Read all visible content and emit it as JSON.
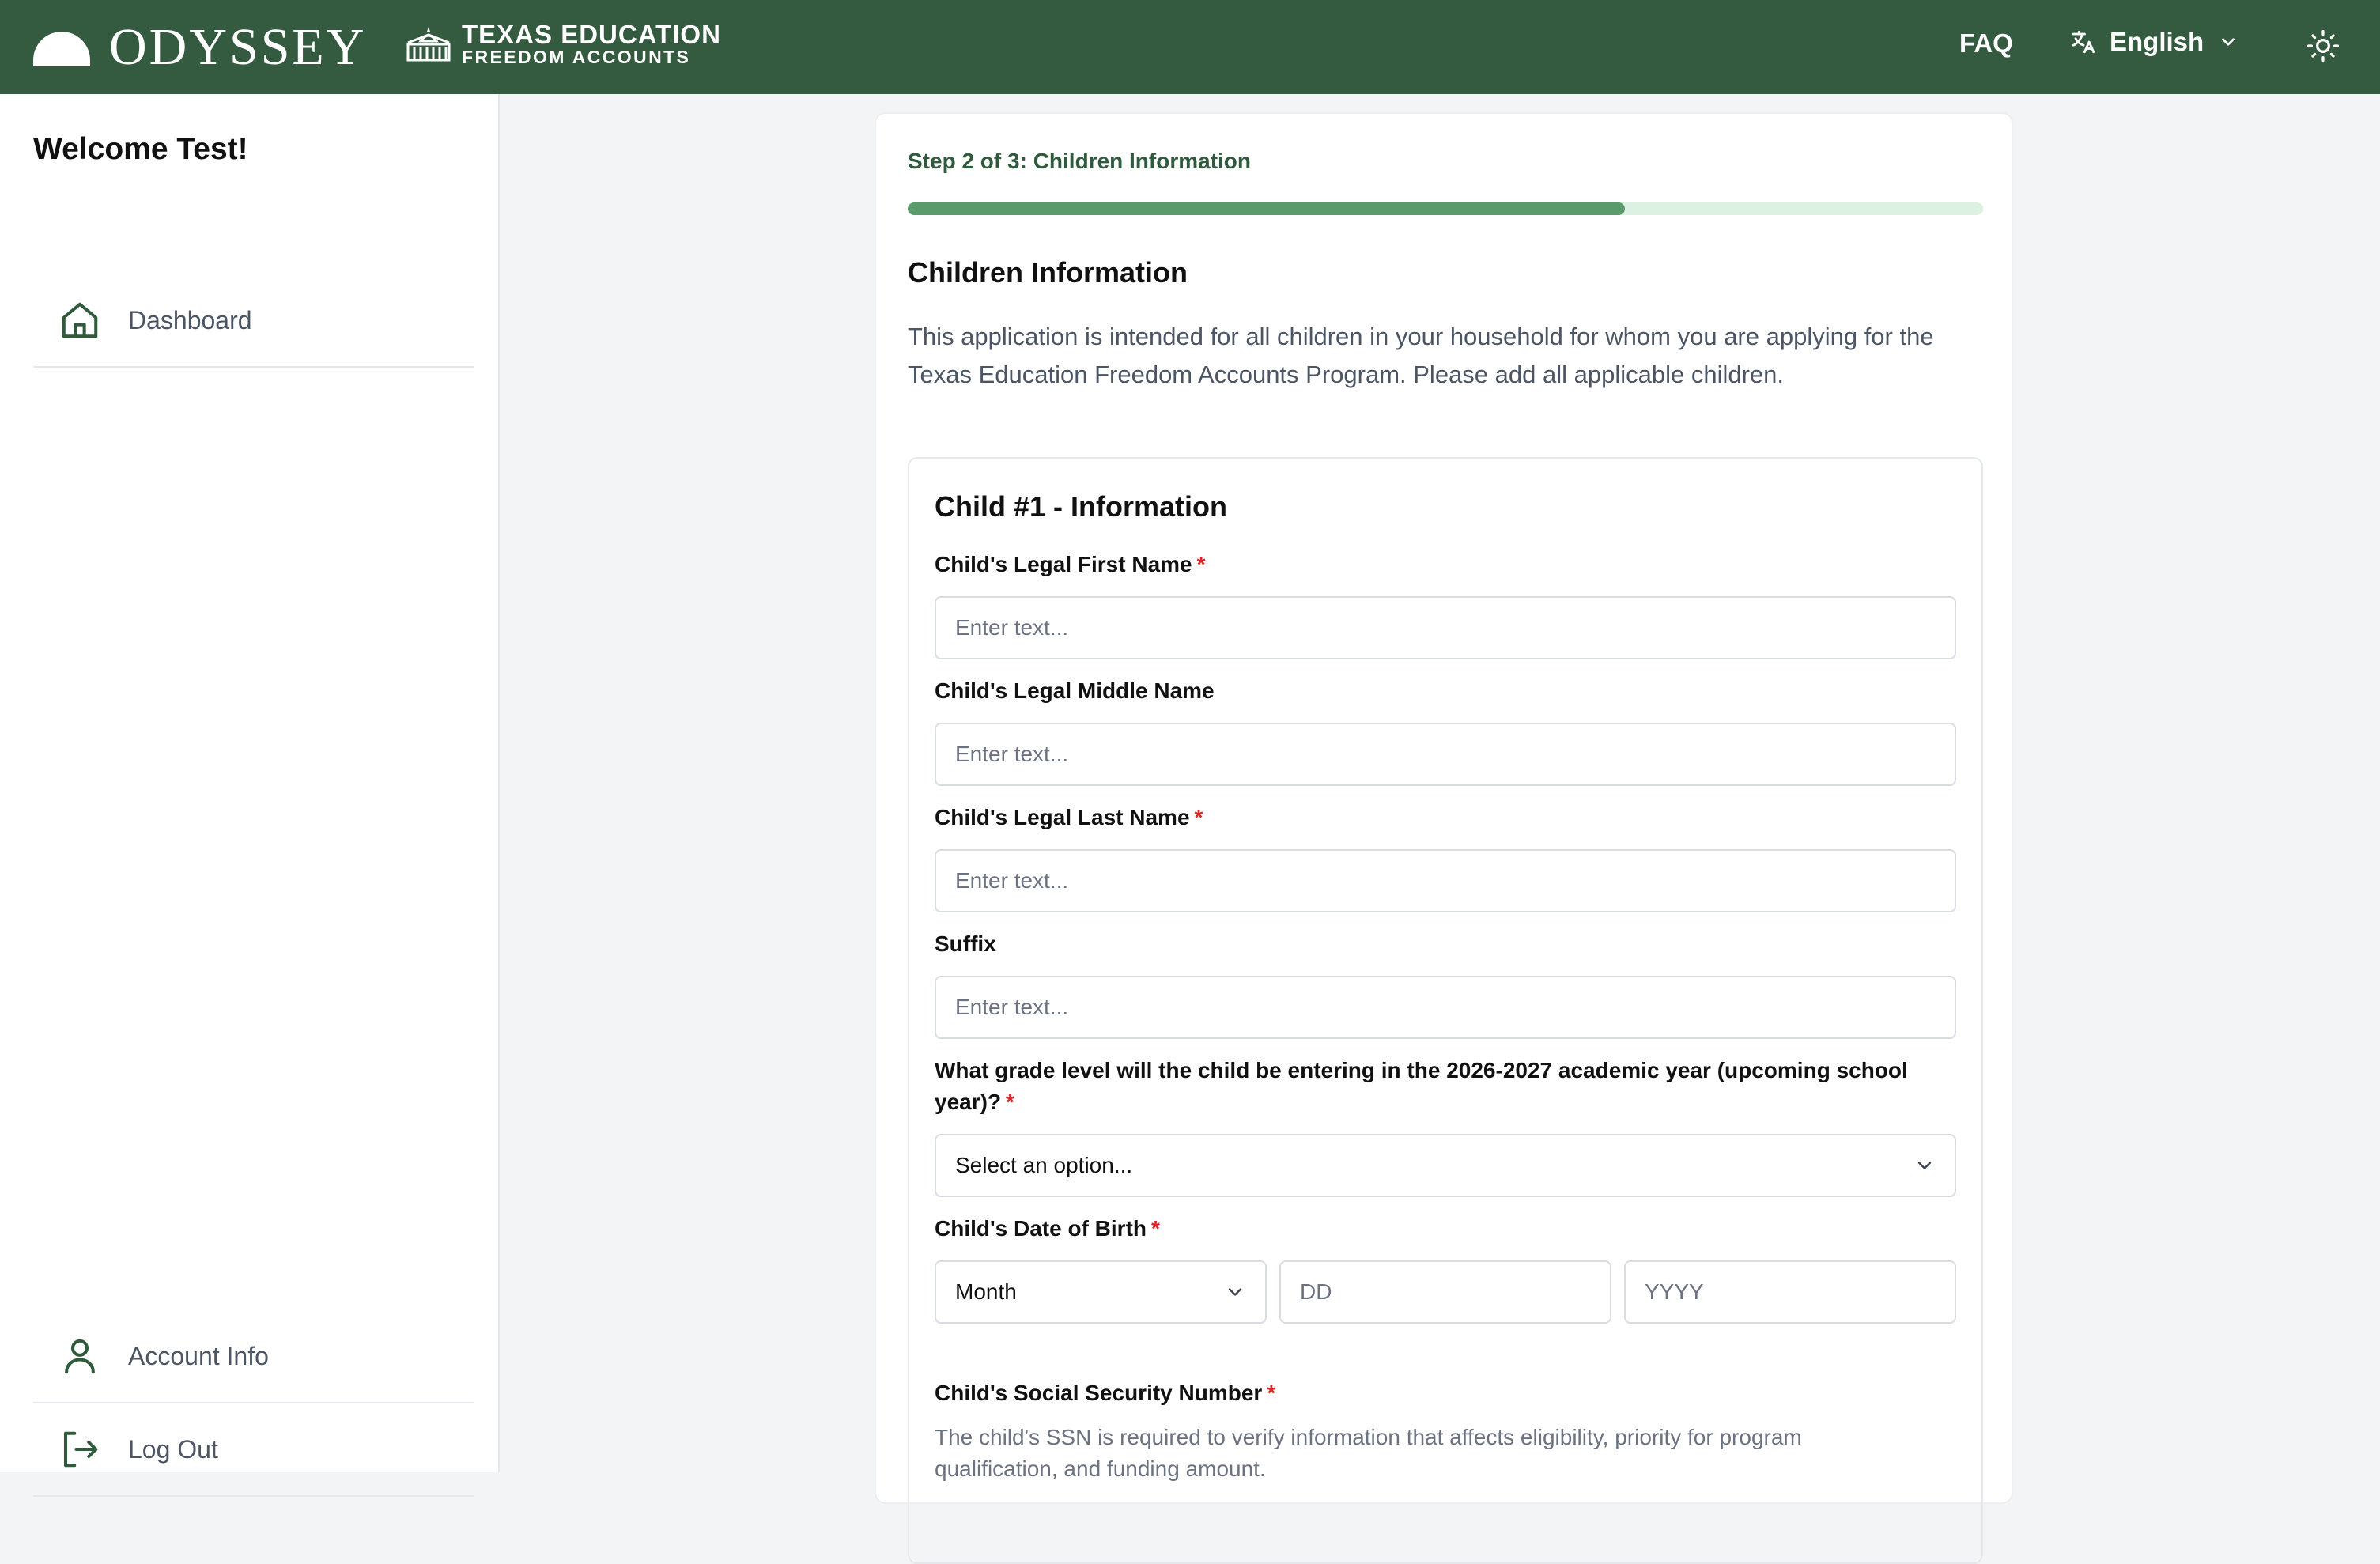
{
  "header": {
    "brand_name": "ODYSSEY",
    "program_line1": "TEXAS EDUCATION",
    "program_line2": "FREEDOM ACCOUNTS",
    "faq_label": "FAQ",
    "language": "English",
    "icons": [
      "odyssey-logo",
      "capitol-logo",
      "translate-icon",
      "chevron-down-icon",
      "sun-icon"
    ],
    "color": "#345b40"
  },
  "sidebar": {
    "welcome": "Welcome Test!",
    "items": [
      {
        "label": "Dashboard",
        "icon": "home-icon"
      },
      {
        "label": "Account Info",
        "icon": "user-icon"
      },
      {
        "label": "Log Out",
        "icon": "logout-icon"
      }
    ]
  },
  "form": {
    "step_label": "Step 2 of 3: Children Information",
    "progress_fraction": 0.667,
    "section_title": "Children Information",
    "section_desc": "This application is intended for all children in your household for whom you are applying for the Texas Education Freedom Accounts Program. Please add all applicable children.",
    "child_title": "Child #1 - Information",
    "required_mark": "*",
    "fields": {
      "first_name": {
        "label": "Child's Legal First Name",
        "placeholder": "Enter text...",
        "value": ""
      },
      "middle_name": {
        "label": "Child's Legal Middle Name",
        "placeholder": "Enter text...",
        "value": ""
      },
      "last_name": {
        "label": "Child's Legal Last Name",
        "placeholder": "Enter text...",
        "value": ""
      },
      "suffix": {
        "label": "Suffix",
        "placeholder": "Enter text...",
        "value": ""
      },
      "grade": {
        "label": "What grade level will the child be entering in the 2026-2027 academic year (upcoming school year)?",
        "selected": "Select an option..."
      },
      "dob": {
        "label": "Child's Date of Birth",
        "month": "Month",
        "day_placeholder": "DD",
        "year_placeholder": "YYYY"
      },
      "ssn": {
        "label": "Child's Social Security Number",
        "helper": "The child's SSN is required to verify information that affects eligibility, priority for program qualification, and funding amount."
      }
    }
  }
}
